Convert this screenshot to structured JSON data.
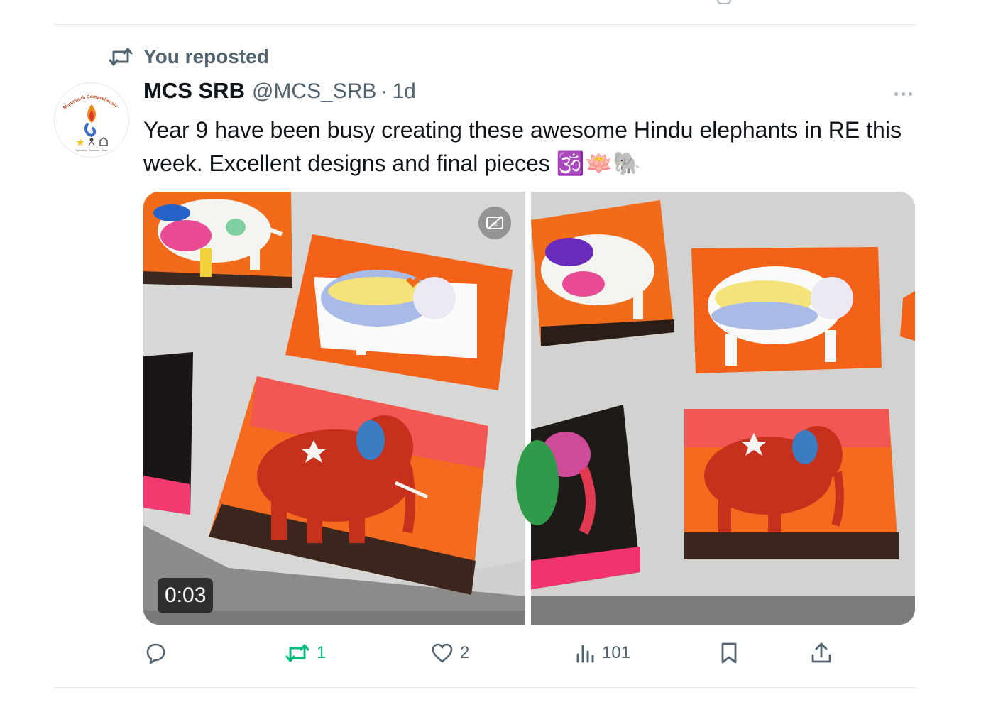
{
  "repost_banner": {
    "label": "You reposted",
    "icon": "repost-icon"
  },
  "tweet": {
    "author_name": "MCS SRB",
    "handle": "@MCS_SRB",
    "separator": "·",
    "time": "1d",
    "text": "Year 9 have been busy creating these awesome Hindu elephants in RE this week. Excellent designs and final pieces 🕉️🪷🐘",
    "avatar": {
      "top_text": "Monmouth Comprehensive",
      "bottom_text": "Specialist · Resource · Base"
    },
    "media": {
      "video_duration": "0:03",
      "left_icon": "captions-off-icon"
    },
    "actions": {
      "reply": {
        "icon": "reply-icon",
        "count": ""
      },
      "repost": {
        "icon": "repost-icon",
        "count": "1",
        "color": "#00ba7c"
      },
      "like": {
        "icon": "heart-icon",
        "count": "2"
      },
      "views": {
        "icon": "views-icon",
        "count": "101"
      },
      "bookmark": {
        "icon": "bookmark-icon"
      },
      "share": {
        "icon": "share-icon"
      }
    }
  },
  "colors": {
    "text_primary": "#0f1419",
    "text_secondary": "#536471",
    "divider": "#e6e9ec"
  }
}
